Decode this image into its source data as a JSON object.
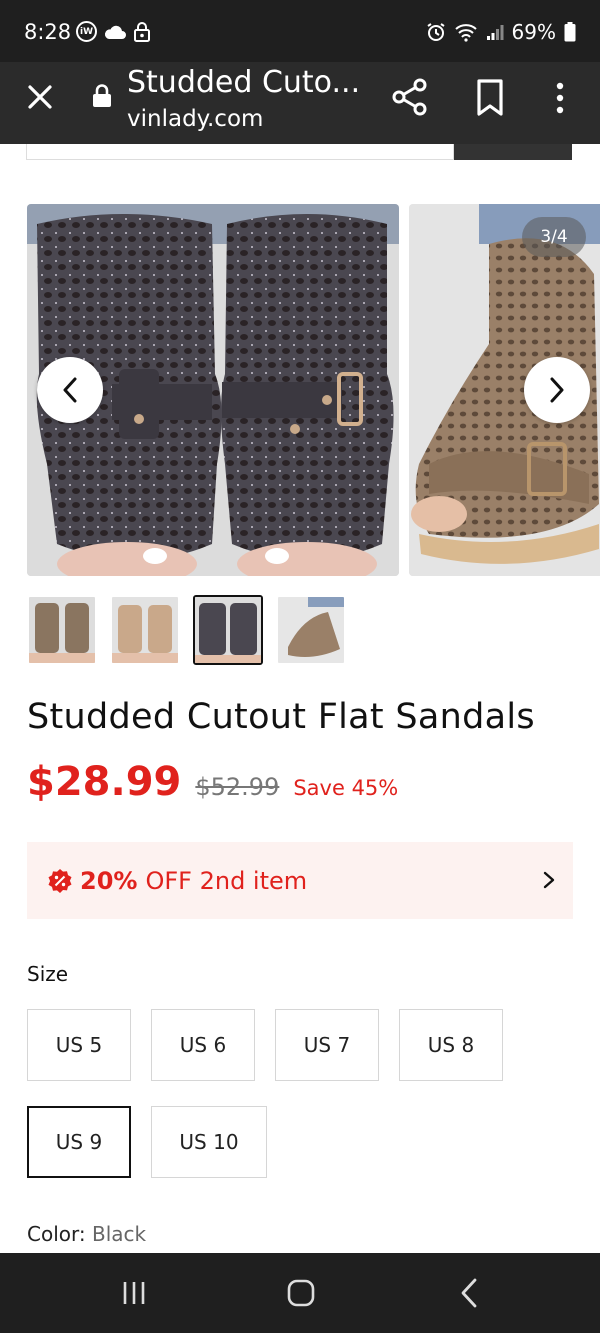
{
  "status_bar": {
    "time": "8:28",
    "iw_badge": "iW",
    "battery": "69%"
  },
  "toolbar": {
    "title": "Studded Cuto...",
    "domain": "vinlady.com"
  },
  "gallery": {
    "counter": "3/4",
    "thumbnail_count": 4,
    "active_thumbnail_index": 2
  },
  "product": {
    "title": "Studded Cutout Flat Sandals",
    "price": "$28.99",
    "old_price": "$52.99",
    "save": "Save 45%"
  },
  "promo": {
    "percent": "20%",
    "text": "OFF 2nd item"
  },
  "size": {
    "label": "Size",
    "options": [
      "US 5",
      "US 6",
      "US 7",
      "US 8",
      "US 9",
      "US 10"
    ],
    "selected": "US 9"
  },
  "color": {
    "label": "Color:",
    "value": "Black"
  },
  "colors": {
    "accent_red": "#e0221d",
    "promo_bg": "#fdf2f0",
    "toolbar_bg": "#2b2b2b",
    "status_bg": "#1f1f1f"
  }
}
